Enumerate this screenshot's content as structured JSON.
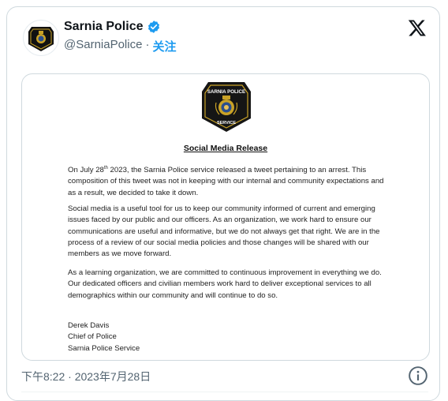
{
  "tweet": {
    "display_name": "Sarnia Police",
    "handle": "@SarniaPolice",
    "separator": "·",
    "follow_label": "关注",
    "timestamp": "下午8:22 · 2023年7月28日"
  },
  "badge": {
    "top_text": "SARNIA POLICE",
    "bottom_text": "SERVICE"
  },
  "release": {
    "title": "Social Media Release",
    "p1_prefix": "On July 28",
    "p1_sup": "th",
    "p1_suffix": " 2023, the Sarnia Police service released a tweet pertaining to an arrest. This composition of this tweet was not in keeping with our internal and community expectations and as a result, we decided to take it down.",
    "p2": "Social media is a useful tool for us to keep our community informed of current and emerging issues faced by our public and our officers.  As an organization, we work hard to ensure our communications are useful and informative, but we do not always get that right.  We are in the process of a review of our social media policies and those changes will be shared with our members as we move forward.",
    "p3": "As a learning organization, we are committed to continuous improvement in everything we do.  Our dedicated officers and civilian members work hard to deliver exceptional services to all demographics within our community and will continue to do so.",
    "sig_name": "Derek Davis",
    "sig_title": "Chief of Police",
    "sig_org": "Sarnia Police Service"
  },
  "colors": {
    "accent": "#1d9bf0",
    "muted": "#536471",
    "border": "#cfd9de"
  },
  "icons": [
    "verified-badge-icon",
    "x-logo-icon",
    "info-icon",
    "police-badge-logo"
  ]
}
